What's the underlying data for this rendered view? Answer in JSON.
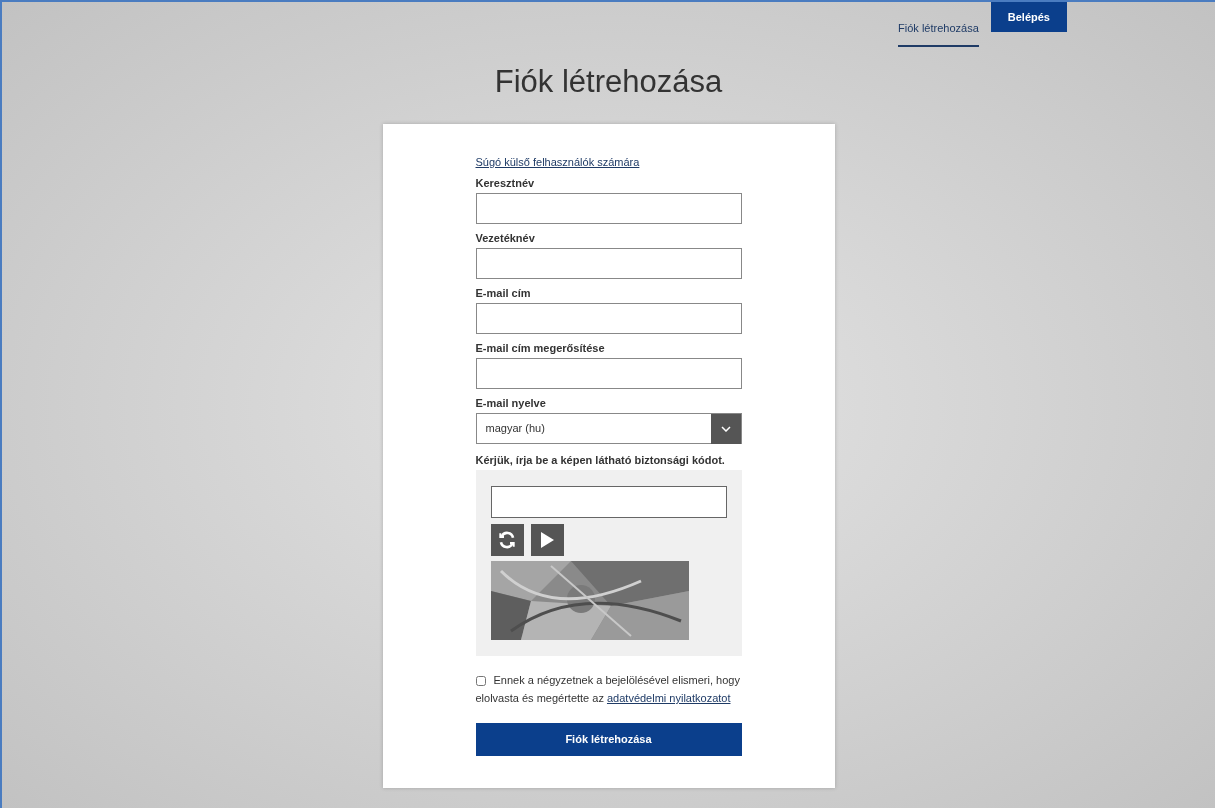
{
  "nav": [
    {
      "kind": "link",
      "label": "Fiók létrehozása",
      "selected": true
    },
    {
      "kind": "button",
      "label": "Belépés",
      "selected": false
    }
  ],
  "title": "Fiók létrehozása",
  "help_link": "Súgó külső felhasználók számára",
  "fields": [
    {
      "kind": "text",
      "label": "Keresztnév"
    },
    {
      "kind": "text",
      "label": "Vezetéknév"
    },
    {
      "kind": "text",
      "label": "E-mail cím"
    },
    {
      "kind": "text",
      "label": "E-mail cím megerősítése"
    },
    {
      "kind": "select",
      "label": "E-mail nyelve",
      "value": "magyar (hu)"
    }
  ],
  "captcha": {
    "prompt": "Kérjük, írja be a képen látható biztonsági kódot."
  },
  "consent": {
    "checked": false,
    "text": "Ennek a négyzetnek a bejelölésével elismeri, hogy elolvasta és megértette az",
    "link": "adatvédelmi nyilatkozatot"
  },
  "submit": "Fiók létrehozása"
}
